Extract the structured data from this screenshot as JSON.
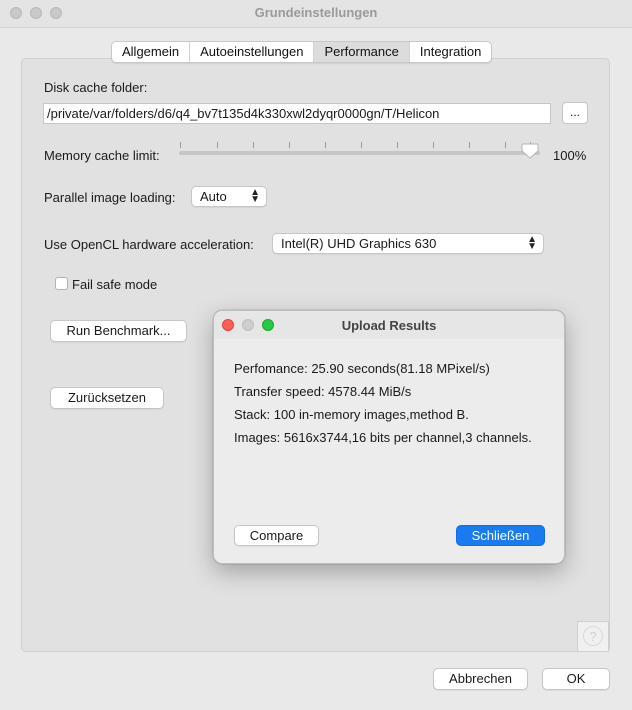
{
  "window": {
    "title": "Grundeinstellungen"
  },
  "tabs": [
    {
      "label": "Allgemein",
      "active": false
    },
    {
      "label": "Autoeinstellungen",
      "active": false
    },
    {
      "label": "Performance",
      "active": true
    },
    {
      "label": "Integration",
      "active": false
    }
  ],
  "settings": {
    "disk_cache_label": "Disk cache folder:",
    "disk_cache_path": "/private/var/folders/d6/q4_bv7t135d4k330xwl2dyqr0000gn/T/Helicon",
    "browse_label": "...",
    "memory_cache_label": "Memory cache limit:",
    "memory_cache_value": "100%",
    "memory_cache_fraction": 1.0,
    "parallel_loading_label": "Parallel image loading:",
    "parallel_loading_value": "Auto",
    "opencl_label": "Use OpenCL hardware acceleration:",
    "opencl_value": "Intel(R) UHD Graphics 630",
    "fail_safe_label": "Fail safe mode",
    "fail_safe_checked": false,
    "run_benchmark_label": "Run Benchmark...",
    "reset_label": "Zurücksetzen",
    "help_label": "?"
  },
  "footer": {
    "cancel_label": "Abbrechen",
    "ok_label": "OK"
  },
  "dialog": {
    "title": "Upload Results",
    "lines": [
      "Perfomance: 25.90 seconds(81.18 MPixel/s)",
      "Transfer speed: 4578.44 MiB/s",
      "Stack: 100 in-memory images,method B.",
      "Images: 5616x3744,16 bits per channel,3 channels."
    ],
    "compare_label": "Compare",
    "close_label": "Schließen"
  },
  "colors": {
    "accent": "#1a7bf0",
    "close_light": "#fe5f57",
    "minimize_light": "#c9c9c9",
    "zoom_light": "#28c840"
  },
  "icons": {
    "chevron": "up-down-chevron-icon",
    "help": "question-icon"
  }
}
